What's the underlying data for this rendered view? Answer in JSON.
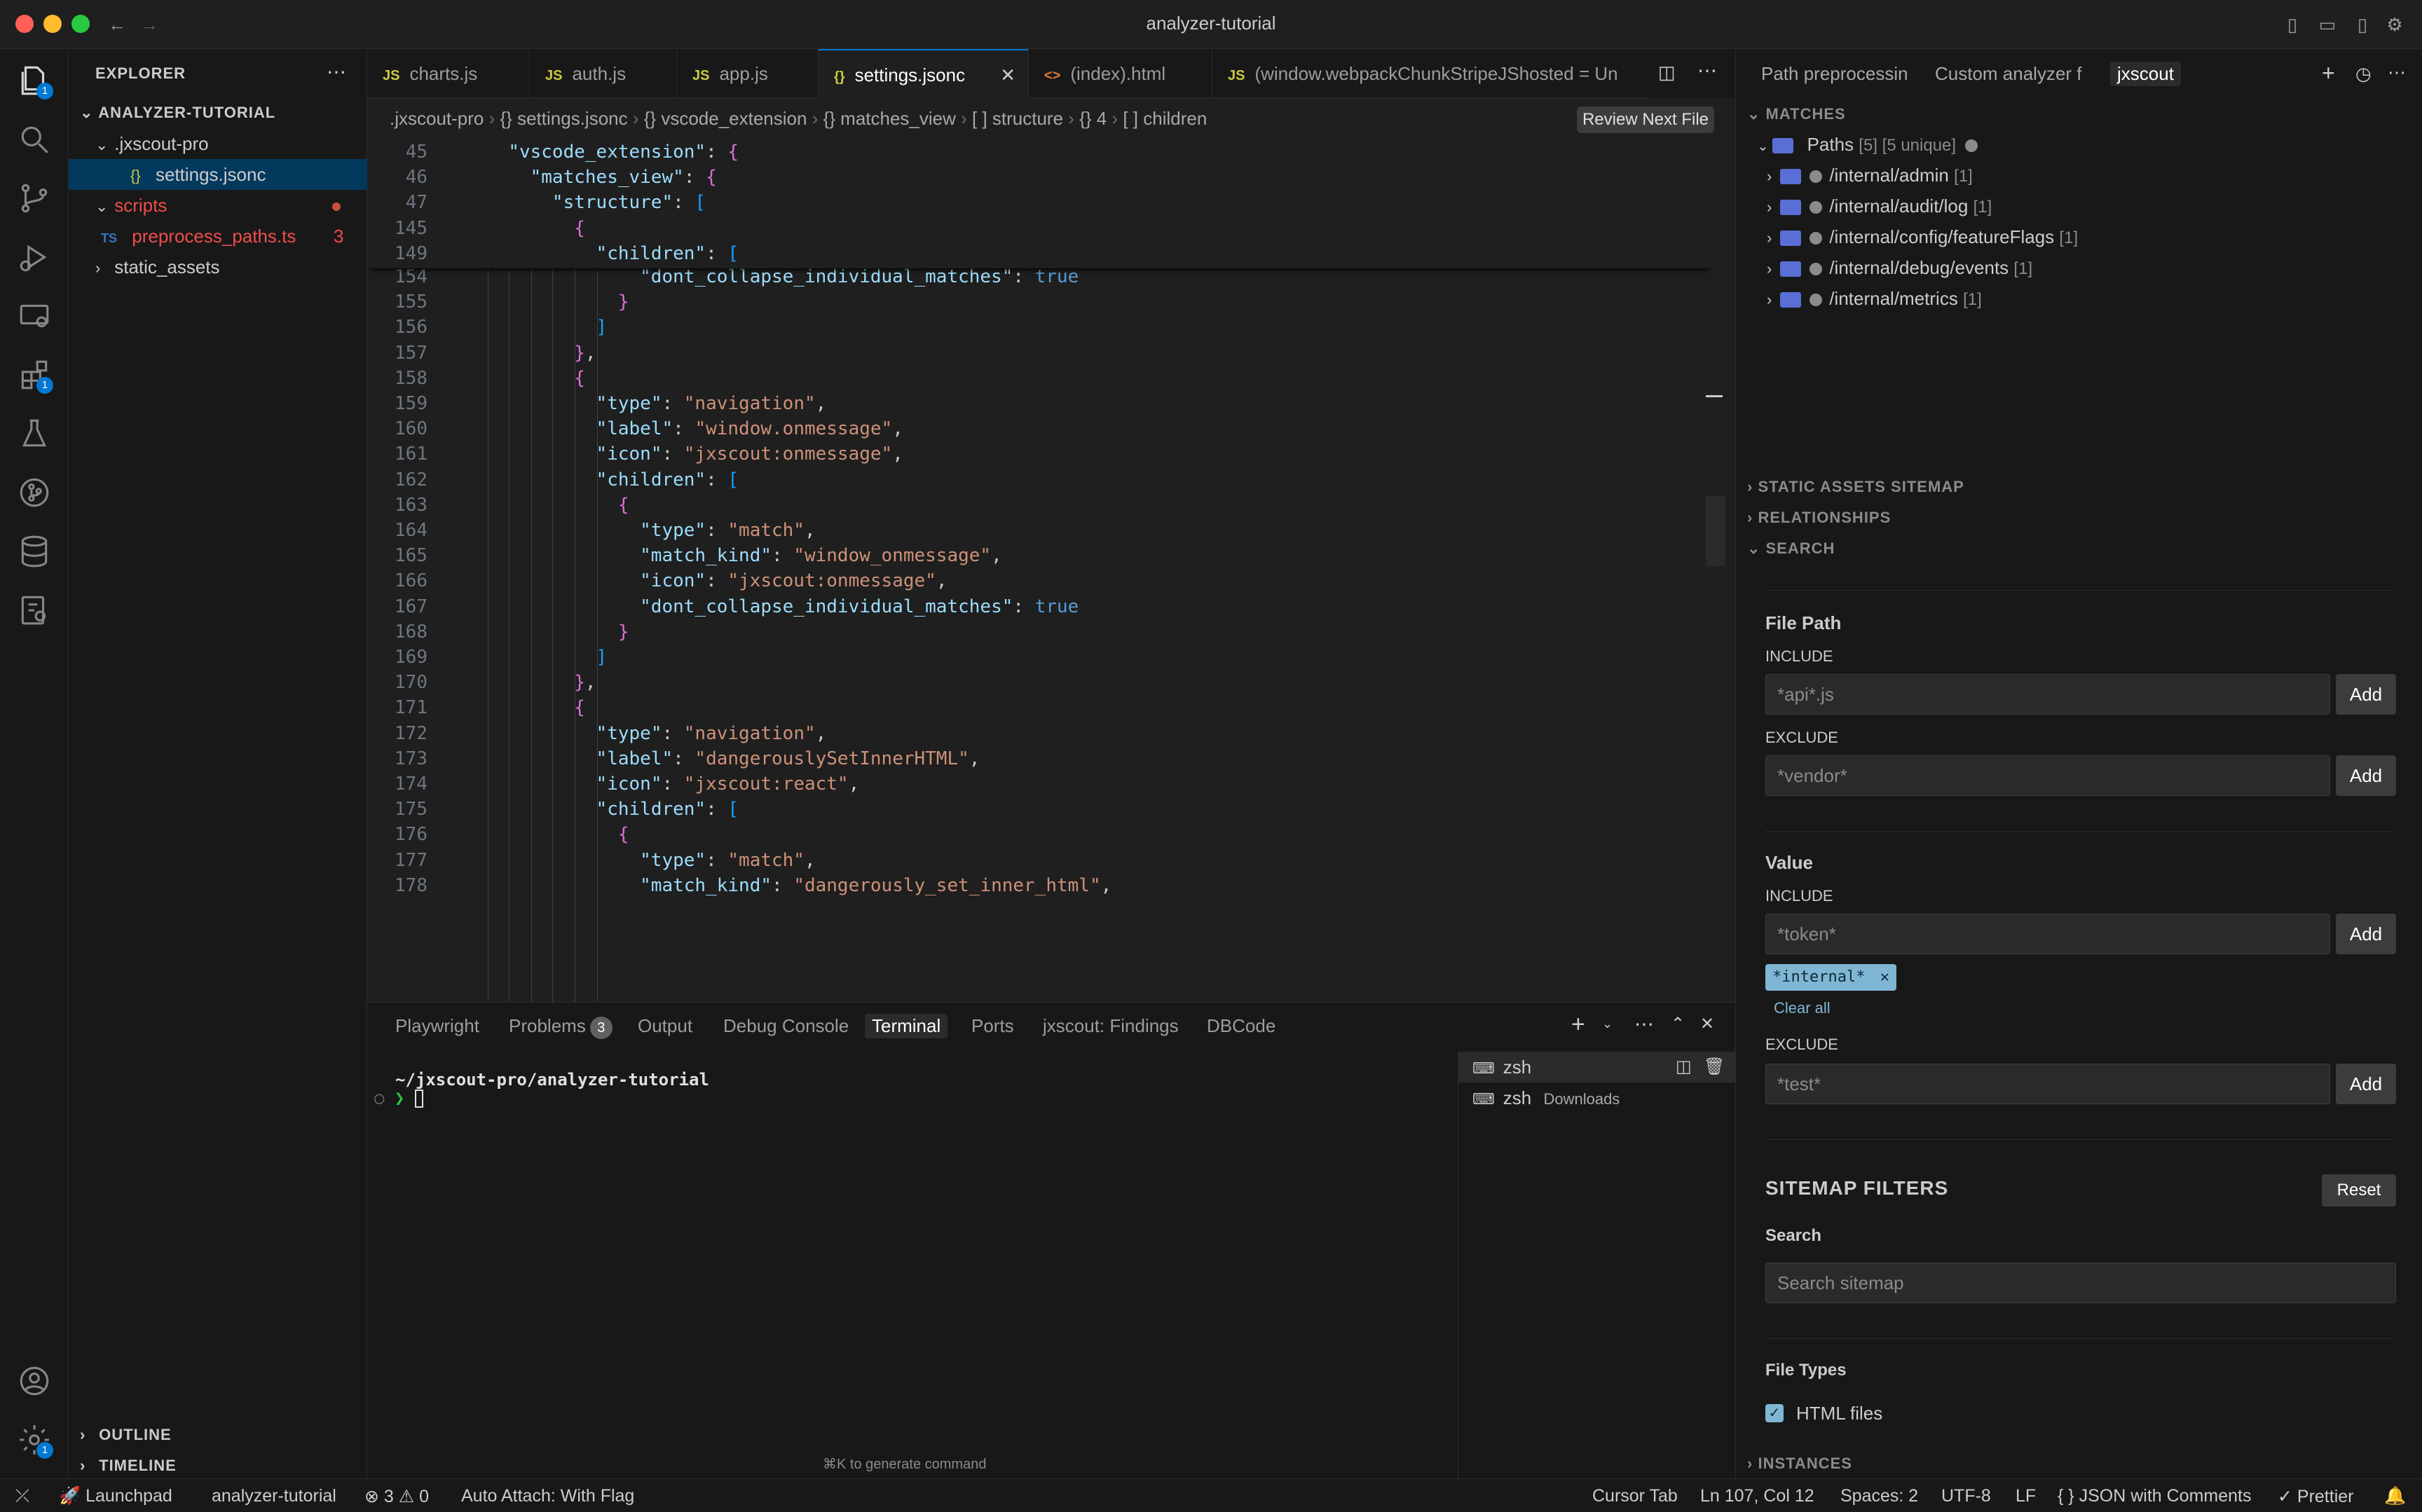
{
  "window": {
    "title": "analyzer-tutorial"
  },
  "activity": {
    "badge_explorer": "1",
    "badge_extensions": "1",
    "badge_settings": "1"
  },
  "explorer": {
    "header": "EXPLORER",
    "project": "ANALYZER-TUTORIAL",
    "items": [
      {
        "label": ".jxscout-pro"
      },
      {
        "label": "settings.jsonc"
      },
      {
        "label": "scripts"
      },
      {
        "label": "preprocess_paths.ts",
        "count": "3"
      },
      {
        "label": "static_assets"
      }
    ],
    "outline": "OUTLINE",
    "timeline": "TIMELINE"
  },
  "tabs": [
    {
      "icon": "JS",
      "label": "charts.js"
    },
    {
      "icon": "JS",
      "label": "auth.js"
    },
    {
      "icon": "JS",
      "label": "app.js"
    },
    {
      "icon": "{}",
      "label": "settings.jsonc"
    },
    {
      "icon": "<>",
      "label": "(index).html"
    },
    {
      "icon": "JS",
      "label": "(window.webpackChunkStripeJShosted = Un"
    }
  ],
  "breadcrumb": {
    "parts": [
      ".jxscout-pro",
      "{} settings.jsonc",
      "{} vscode_extension",
      "{} matches_view",
      "[ ] structure",
      "{} 4",
      "[ ] children"
    ],
    "review_button": "Review Next File"
  },
  "code": {
    "sticky": [
      {
        "n": "45",
        "t": "  \"vscode_extension\": {"
      },
      {
        "n": "46",
        "t": "    \"matches_view\": {"
      },
      {
        "n": "47",
        "t": "      \"structure\": ["
      },
      {
        "n": "145",
        "t": "        {"
      },
      {
        "n": "149",
        "t": "          \"children\": ["
      }
    ],
    "lines": [
      {
        "n": "154",
        "t": "              \"dont_collapse_individual_matches\": true"
      },
      {
        "n": "155",
        "t": "            }"
      },
      {
        "n": "156",
        "t": "          ]"
      },
      {
        "n": "157",
        "t": "        },"
      },
      {
        "n": "158",
        "t": "        {"
      },
      {
        "n": "159",
        "t": "          \"type\": \"navigation\","
      },
      {
        "n": "160",
        "t": "          \"label\": \"window.onmessage\","
      },
      {
        "n": "161",
        "t": "          \"icon\": \"jxscout:onmessage\","
      },
      {
        "n": "162",
        "t": "          \"children\": ["
      },
      {
        "n": "163",
        "t": "            {"
      },
      {
        "n": "164",
        "t": "              \"type\": \"match\","
      },
      {
        "n": "165",
        "t": "              \"match_kind\": \"window_onmessage\","
      },
      {
        "n": "166",
        "t": "              \"icon\": \"jxscout:onmessage\","
      },
      {
        "n": "167",
        "t": "              \"dont_collapse_individual_matches\": true"
      },
      {
        "n": "168",
        "t": "            }"
      },
      {
        "n": "169",
        "t": "          ]"
      },
      {
        "n": "170",
        "t": "        },"
      },
      {
        "n": "171",
        "t": "        {"
      },
      {
        "n": "172",
        "t": "          \"type\": \"navigation\","
      },
      {
        "n": "173",
        "t": "          \"label\": \"dangerouslySetInnerHTML\","
      },
      {
        "n": "174",
        "t": "          \"icon\": \"jxscout:react\","
      },
      {
        "n": "175",
        "t": "          \"children\": ["
      },
      {
        "n": "176",
        "t": "            {"
      },
      {
        "n": "177",
        "t": "              \"type\": \"match\","
      },
      {
        "n": "178",
        "t": "              \"match_kind\": \"dangerously_set_inner_html\","
      }
    ]
  },
  "panel": {
    "tabs": [
      "Playwright",
      "Problems",
      "Output",
      "Debug Console",
      "Terminal",
      "Ports",
      "jxscout: Findings",
      "DBCode"
    ],
    "problems_count": "3",
    "terminal_path": "~/jxscout-pro/analyzer-tutorial",
    "prompt": "❯",
    "hint": "⌘K to generate command",
    "terminals": [
      {
        "name": "zsh",
        "detail": ""
      },
      {
        "name": "zsh",
        "detail": "Downloads"
      }
    ]
  },
  "right": {
    "tabs": [
      "Path preprocessin",
      "Custom analyzer fo",
      "jxscout"
    ],
    "matches_header": "MATCHES",
    "paths_label": "Paths",
    "paths_count": "[5] [5 unique]",
    "paths": [
      {
        "path": "/internal/admin",
        "count": "[1]"
      },
      {
        "path": "/internal/audit/log",
        "count": "[1]"
      },
      {
        "path": "/internal/config/featureFlags",
        "count": "[1]"
      },
      {
        "path": "/internal/debug/events",
        "count": "[1]"
      },
      {
        "path": "/internal/metrics",
        "count": "[1]"
      }
    ],
    "static_assets": "STATIC ASSETS SITEMAP",
    "relationships": "RELATIONSHIPS",
    "search": "SEARCH",
    "file_path": {
      "title": "File Path",
      "include_label": "INCLUDE",
      "include_placeholder": "*api*.js",
      "exclude_label": "EXCLUDE",
      "exclude_placeholder": "*vendor*",
      "add": "Add"
    },
    "value": {
      "title": "Value",
      "include_label": "INCLUDE",
      "include_placeholder": "*token*",
      "chip": "*internal*",
      "clear_all": "Clear all",
      "exclude_label": "EXCLUDE",
      "exclude_placeholder": "*test*",
      "add": "Add"
    },
    "sitemap": {
      "title": "SITEMAP FILTERS",
      "reset": "Reset",
      "search_label": "Search",
      "search_placeholder": "Search sitemap",
      "file_types_label": "File Types",
      "html_files": "HTML files"
    },
    "instances": "INSTANCES"
  },
  "status": {
    "launchpad": "Launchpad",
    "project": "analyzer-tutorial",
    "problems": "⊗ 3 ⚠ 0",
    "auto_attach": "Auto Attach: With Flag",
    "cursor_tab": "Cursor Tab",
    "position": "Ln 107, Col 12",
    "spaces": "Spaces: 2",
    "encoding": "UTF-8",
    "eol": "LF",
    "language": "{ } JSON with Comments",
    "prettier": "✓ Prettier"
  }
}
